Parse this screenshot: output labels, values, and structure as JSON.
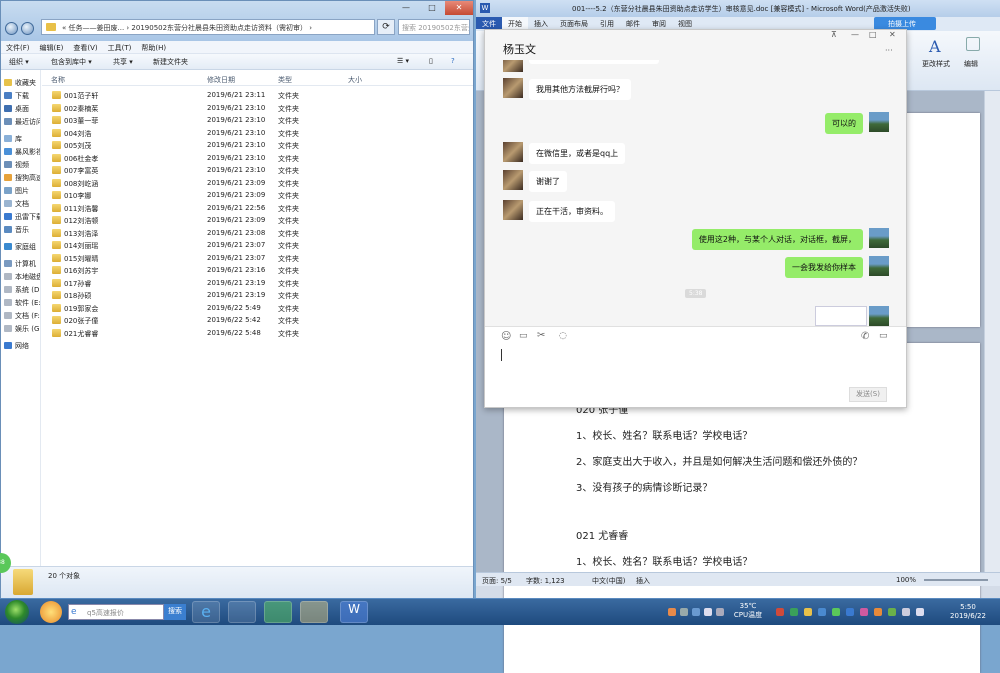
{
  "explorer": {
    "address_text": "« 任务——姜田废... › 20190502东营分社晨县朱田资助点走访资料（需初审） ›",
    "search_placeholder": "搜索 20190502东营分...",
    "menu": [
      "文件(F)",
      "编辑(E)",
      "查看(V)",
      "工具(T)",
      "帮助(H)"
    ],
    "toolbar": {
      "organize": "组织 ▾",
      "include": "包含到库中 ▾",
      "share": "共享 ▾",
      "new_folder": "新建文件夹"
    },
    "nav": [
      {
        "label": "收藏夹",
        "color": "#e7c24a"
      },
      {
        "label": "下载",
        "color": "#4a7fc4"
      },
      {
        "label": "桌面",
        "color": "#3f6fb0"
      },
      {
        "label": "最近访问的位置",
        "color": "#6c8fb8"
      },
      {
        "label": "",
        "color": "#fff"
      },
      {
        "label": "库",
        "color": "#8ab0d8"
      },
      {
        "label": "暴风影视库",
        "color": "#4a90d8"
      },
      {
        "label": "视频",
        "color": "#6c8fb8"
      },
      {
        "label": "搜狗高速下载",
        "color": "#e7a23a"
      },
      {
        "label": "图片",
        "color": "#7aa2c8"
      },
      {
        "label": "文档",
        "color": "#9ab4d0"
      },
      {
        "label": "迅雷下载",
        "color": "#3a7ad0"
      },
      {
        "label": "音乐",
        "color": "#5a8ac0"
      },
      {
        "label": "",
        "color": "#fff"
      },
      {
        "label": "家庭组",
        "color": "#3a8ad0"
      },
      {
        "label": "",
        "color": "#fff"
      },
      {
        "label": "计算机",
        "color": "#7a9ac0"
      },
      {
        "label": "本地磁盘 (C:)",
        "color": "#b0b8c4"
      },
      {
        "label": "系统 (D:)",
        "color": "#b0b8c4"
      },
      {
        "label": "软件 (E:)",
        "color": "#b0b8c4"
      },
      {
        "label": "文档 (F:)",
        "color": "#b0b8c4"
      },
      {
        "label": "娱乐 (G:)",
        "color": "#b0b8c4"
      },
      {
        "label": "",
        "color": "#fff"
      },
      {
        "label": "网络",
        "color": "#3a7ad0"
      }
    ],
    "columns": {
      "name": "名称",
      "date": "修改日期",
      "type": "类型",
      "size": "大小"
    },
    "files": [
      {
        "name": "001范子轩",
        "date": "2019/6/21 23:11",
        "type": "文件夹"
      },
      {
        "name": "002秦楠茱",
        "date": "2019/6/21 23:10",
        "type": "文件夹"
      },
      {
        "name": "003董一菲",
        "date": "2019/6/21 23:10",
        "type": "文件夹"
      },
      {
        "name": "004刘浩",
        "date": "2019/6/21 23:10",
        "type": "文件夹"
      },
      {
        "name": "005刘茂",
        "date": "2019/6/21 23:10",
        "type": "文件夹"
      },
      {
        "name": "006杜金孝",
        "date": "2019/6/21 23:10",
        "type": "文件夹"
      },
      {
        "name": "007李富英",
        "date": "2019/6/21 23:10",
        "type": "文件夹"
      },
      {
        "name": "008刘屹涵",
        "date": "2019/6/21 23:09",
        "type": "文件夹"
      },
      {
        "name": "010李娜",
        "date": "2019/6/21 23:09",
        "type": "文件夹"
      },
      {
        "name": "011刘浩馨",
        "date": "2019/6/21 22:56",
        "type": "文件夹"
      },
      {
        "name": "012刘浩顿",
        "date": "2019/6/21 23:09",
        "type": "文件夹"
      },
      {
        "name": "013刘浩泽",
        "date": "2019/6/21 23:08",
        "type": "文件夹"
      },
      {
        "name": "014刘丽瑶",
        "date": "2019/6/21 23:07",
        "type": "文件夹"
      },
      {
        "name": "015刘曜晴",
        "date": "2019/6/21 23:07",
        "type": "文件夹"
      },
      {
        "name": "016刘苏宇",
        "date": "2019/6/21 23:16",
        "type": "文件夹"
      },
      {
        "name": "017孙睿",
        "date": "2019/6/21 23:19",
        "type": "文件夹"
      },
      {
        "name": "018孙硕",
        "date": "2019/6/21 23:19",
        "type": "文件夹"
      },
      {
        "name": "019郭家会",
        "date": "2019/6/22 5:49",
        "type": "文件夹"
      },
      {
        "name": "020张子僮",
        "date": "2019/6/22 5:42",
        "type": "文件夹"
      },
      {
        "name": "021尤睿睿",
        "date": "2019/6/22 5:48",
        "type": "文件夹"
      }
    ],
    "status_count": "20 个对象"
  },
  "word": {
    "title": "001----5.2（东营分社晨县朱田资助点走访学生）审核意见.doc [兼容模式] - Microsoft Word(产品激活失败)",
    "tabs": [
      "文件",
      "开始",
      "插入",
      "页面布局",
      "引用",
      "邮件",
      "审阅",
      "视图"
    ],
    "upload_label": "拍摄上传",
    "ribbon_labels": {
      "styles": "更改样式",
      "edit": "编辑"
    },
    "doc_lines": [
      "020 张子僮",
      "1、校长、姓名？联系电话？学校电话？",
      "2、家庭支出大于收入，并且是如何解决生活问题和偿还外债的？",
      "3、没有孩子的病情诊断记录？",
      "",
      "021 尤睿睿",
      "1、校长、姓名？联系电话？学校电话？"
    ],
    "status": {
      "page": "页面: 5/5",
      "words": "字数: 1,123",
      "lang": "中文(中国)",
      "mode": "插入",
      "zoom": "100%"
    }
  },
  "chat": {
    "contact": "杨玉文",
    "more": "···",
    "messages": [
      {
        "side": "in",
        "text": "我用其他方法截屏行吗？"
      },
      {
        "side": "out",
        "text": "可以的"
      },
      {
        "side": "in",
        "text": "在微信里，或者是qq上"
      },
      {
        "side": "in",
        "text": "谢谢了"
      },
      {
        "side": "in",
        "text": "正在干活，审资料。"
      },
      {
        "side": "out",
        "text": "使用这2种，与某个人对话，对话框，截屏，"
      },
      {
        "side": "out",
        "text": "一会我发给你样本"
      }
    ],
    "timestamp": "5:38",
    "send_label": "发送(S)"
  },
  "taskbar": {
    "search_placeholder": "q5高速报价",
    "search_button": "搜索",
    "cpu_temp": "35℃",
    "cpu_label": "CPU温度",
    "time": "5:50",
    "date": "2019/6/22"
  }
}
